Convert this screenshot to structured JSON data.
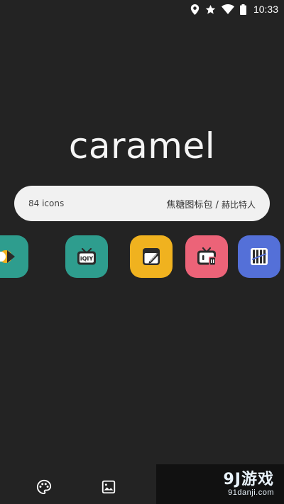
{
  "status_bar": {
    "time": "10:33",
    "icons": [
      "location-icon",
      "star-icon",
      "wifi-icon",
      "battery-icon"
    ]
  },
  "title": "caramel",
  "info_pill": {
    "icon_count": "84 icons",
    "pack_name": "焦糖图标包 / ",
    "author": "赫比特人"
  },
  "carousel": {
    "icons": [
      {
        "name": "overlap-app-icon",
        "color": "#2e9d8e"
      },
      {
        "name": "iqiyi-tv-icon",
        "color": "#2e9d8e"
      },
      {
        "name": "notes-edit-icon",
        "color": "#f0b21f"
      },
      {
        "name": "bilibili-tv-icon",
        "color": "#ec6378"
      },
      {
        "name": "bar-chart-app-icon",
        "color": "#5470d8"
      }
    ]
  },
  "bottom_nav": {
    "items": [
      "palette-icon",
      "image-icon"
    ]
  },
  "watermark": {
    "main": "9J游戏",
    "sub": "91danji.com"
  },
  "colors": {
    "background": "#232323",
    "pill": "#f1f1f1",
    "teal": "#2e9d8e",
    "yellow": "#f0b21f",
    "pink": "#ec6378",
    "blue": "#5470d8"
  }
}
